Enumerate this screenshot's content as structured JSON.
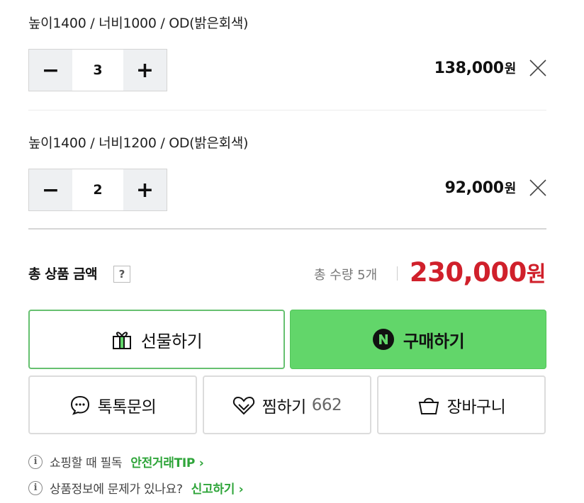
{
  "items": [
    {
      "name": "높이1400 / 너비1000 / OD(밝은회색)",
      "quantity": "3",
      "price": "138,000",
      "currency": "원"
    },
    {
      "name": "높이1400 / 너비1200 / OD(밝은회색)",
      "quantity": "2",
      "price": "92,000",
      "currency": "원"
    }
  ],
  "stepper": {
    "minus": "−",
    "plus": "+"
  },
  "total": {
    "label": "총 상품 금액",
    "help": "?",
    "quantity_text": "총 수량 5개",
    "price": "230,000",
    "currency": "원"
  },
  "buttons": {
    "gift": "선물하기",
    "buy": "구매하기",
    "talk": "톡톡문의",
    "wish": "찜하기",
    "wish_count": "662",
    "cart": "장바구니"
  },
  "notes": [
    {
      "text": "쇼핑할 때 필독",
      "link": "안전거래TIP",
      "arrow": "›"
    },
    {
      "text": "상품정보에 문제가 있나요?",
      "link": "신고하기",
      "arrow": "›"
    }
  ],
  "info_glyph": "i",
  "colors": {
    "accent_green": "#62d66a",
    "link_green": "#2fa53a",
    "price_red": "#d0202b"
  },
  "icons": [
    "minus-icon",
    "plus-icon",
    "close-icon",
    "gift-icon",
    "naver-pay-icon",
    "chat-icon",
    "heart-icon",
    "cart-icon",
    "info-icon",
    "chevron-right-icon"
  ]
}
